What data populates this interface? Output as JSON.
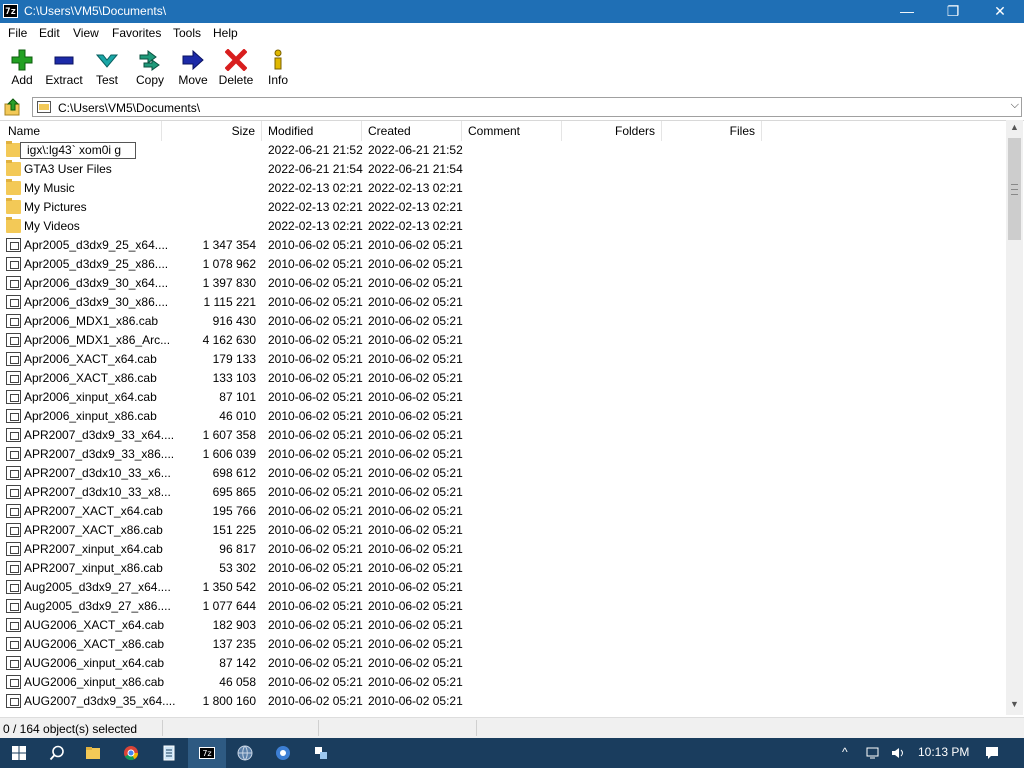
{
  "window": {
    "title": "C:\\Users\\VM5\\Documents\\",
    "app_icon": "7z",
    "min": "—",
    "max": "❐",
    "close": "✕"
  },
  "menu": [
    "File",
    "Edit",
    "View",
    "Favorites",
    "Tools",
    "Help"
  ],
  "toolbar": [
    {
      "label": "Add",
      "icon": "plus-icon",
      "color": "#22a022"
    },
    {
      "label": "Extract",
      "icon": "minus-icon",
      "color": "#1c2aa8"
    },
    {
      "label": "Test",
      "icon": "check-icon",
      "color": "#1aa6a6"
    },
    {
      "label": "Copy",
      "icon": "double-arrow-icon",
      "color": "#1f9a7a"
    },
    {
      "label": "Move",
      "icon": "arrow-right-icon",
      "color": "#1c2aa8"
    },
    {
      "label": "Delete",
      "icon": "x-icon",
      "color": "#d81e1e"
    },
    {
      "label": "Info",
      "icon": "info-icon",
      "color": "#c8a000"
    }
  ],
  "address": {
    "path": "C:\\Users\\VM5\\Documents\\"
  },
  "columns": [
    "Name",
    "Size",
    "Modified",
    "Created",
    "Comment",
    "Folders",
    "Files"
  ],
  "rename_value": "igx\\:lg43` xom0i g",
  "rows": [
    {
      "name": "",
      "size": "",
      "modified": "2022-06-21 21:52",
      "created": "2022-06-21 21:52",
      "type": "folder",
      "editing": true
    },
    {
      "name": "GTA3 User Files",
      "size": "",
      "modified": "2022-06-21 21:54",
      "created": "2022-06-21 21:54",
      "type": "folder"
    },
    {
      "name": "My Music",
      "size": "",
      "modified": "2022-02-13 02:21",
      "created": "2022-02-13 02:21",
      "type": "folder"
    },
    {
      "name": "My Pictures",
      "size": "",
      "modified": "2022-02-13 02:21",
      "created": "2022-02-13 02:21",
      "type": "folder"
    },
    {
      "name": "My Videos",
      "size": "",
      "modified": "2022-02-13 02:21",
      "created": "2022-02-13 02:21",
      "type": "folder"
    },
    {
      "name": "Apr2005_d3dx9_25_x64....",
      "size": "1 347 354",
      "modified": "2010-06-02 05:21",
      "created": "2010-06-02 05:21",
      "type": "cab"
    },
    {
      "name": "Apr2005_d3dx9_25_x86....",
      "size": "1 078 962",
      "modified": "2010-06-02 05:21",
      "created": "2010-06-02 05:21",
      "type": "cab"
    },
    {
      "name": "Apr2006_d3dx9_30_x64....",
      "size": "1 397 830",
      "modified": "2010-06-02 05:21",
      "created": "2010-06-02 05:21",
      "type": "cab"
    },
    {
      "name": "Apr2006_d3dx9_30_x86....",
      "size": "1 115 221",
      "modified": "2010-06-02 05:21",
      "created": "2010-06-02 05:21",
      "type": "cab"
    },
    {
      "name": "Apr2006_MDX1_x86.cab",
      "size": "916 430",
      "modified": "2010-06-02 05:21",
      "created": "2010-06-02 05:21",
      "type": "cab"
    },
    {
      "name": "Apr2006_MDX1_x86_Arc...",
      "size": "4 162 630",
      "modified": "2010-06-02 05:21",
      "created": "2010-06-02 05:21",
      "type": "cab"
    },
    {
      "name": "Apr2006_XACT_x64.cab",
      "size": "179 133",
      "modified": "2010-06-02 05:21",
      "created": "2010-06-02 05:21",
      "type": "cab"
    },
    {
      "name": "Apr2006_XACT_x86.cab",
      "size": "133 103",
      "modified": "2010-06-02 05:21",
      "created": "2010-06-02 05:21",
      "type": "cab"
    },
    {
      "name": "Apr2006_xinput_x64.cab",
      "size": "87 101",
      "modified": "2010-06-02 05:21",
      "created": "2010-06-02 05:21",
      "type": "cab"
    },
    {
      "name": "Apr2006_xinput_x86.cab",
      "size": "46 010",
      "modified": "2010-06-02 05:21",
      "created": "2010-06-02 05:21",
      "type": "cab"
    },
    {
      "name": "APR2007_d3dx9_33_x64....",
      "size": "1 607 358",
      "modified": "2010-06-02 05:21",
      "created": "2010-06-02 05:21",
      "type": "cab"
    },
    {
      "name": "APR2007_d3dx9_33_x86....",
      "size": "1 606 039",
      "modified": "2010-06-02 05:21",
      "created": "2010-06-02 05:21",
      "type": "cab"
    },
    {
      "name": "APR2007_d3dx10_33_x6...",
      "size": "698 612",
      "modified": "2010-06-02 05:21",
      "created": "2010-06-02 05:21",
      "type": "cab"
    },
    {
      "name": "APR2007_d3dx10_33_x8...",
      "size": "695 865",
      "modified": "2010-06-02 05:21",
      "created": "2010-06-02 05:21",
      "type": "cab"
    },
    {
      "name": "APR2007_XACT_x64.cab",
      "size": "195 766",
      "modified": "2010-06-02 05:21",
      "created": "2010-06-02 05:21",
      "type": "cab"
    },
    {
      "name": "APR2007_XACT_x86.cab",
      "size": "151 225",
      "modified": "2010-06-02 05:21",
      "created": "2010-06-02 05:21",
      "type": "cab"
    },
    {
      "name": "APR2007_xinput_x64.cab",
      "size": "96 817",
      "modified": "2010-06-02 05:21",
      "created": "2010-06-02 05:21",
      "type": "cab"
    },
    {
      "name": "APR2007_xinput_x86.cab",
      "size": "53 302",
      "modified": "2010-06-02 05:21",
      "created": "2010-06-02 05:21",
      "type": "cab"
    },
    {
      "name": "Aug2005_d3dx9_27_x64....",
      "size": "1 350 542",
      "modified": "2010-06-02 05:21",
      "created": "2010-06-02 05:21",
      "type": "cab"
    },
    {
      "name": "Aug2005_d3dx9_27_x86....",
      "size": "1 077 644",
      "modified": "2010-06-02 05:21",
      "created": "2010-06-02 05:21",
      "type": "cab"
    },
    {
      "name": "AUG2006_XACT_x64.cab",
      "size": "182 903",
      "modified": "2010-06-02 05:21",
      "created": "2010-06-02 05:21",
      "type": "cab"
    },
    {
      "name": "AUG2006_XACT_x86.cab",
      "size": "137 235",
      "modified": "2010-06-02 05:21",
      "created": "2010-06-02 05:21",
      "type": "cab"
    },
    {
      "name": "AUG2006_xinput_x64.cab",
      "size": "87 142",
      "modified": "2010-06-02 05:21",
      "created": "2010-06-02 05:21",
      "type": "cab"
    },
    {
      "name": "AUG2006_xinput_x86.cab",
      "size": "46 058",
      "modified": "2010-06-02 05:21",
      "created": "2010-06-02 05:21",
      "type": "cab"
    },
    {
      "name": "AUG2007_d3dx9_35_x64....",
      "size": "1 800 160",
      "modified": "2010-06-02 05:21",
      "created": "2010-06-02 05:21",
      "type": "cab"
    }
  ],
  "status": {
    "text": "0 / 164 object(s) selected"
  },
  "taskbar": {
    "clock": "10:13 PM"
  }
}
